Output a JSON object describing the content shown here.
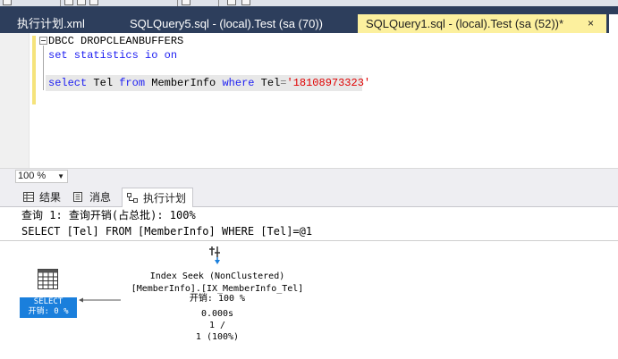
{
  "tabs": [
    {
      "label": "执行计划.xml",
      "active": false
    },
    {
      "label": "SQLQuery5.sql - (local).Test (sa (70))",
      "active": false
    },
    {
      "label": "SQLQuery1.sql - (local).Test (sa (52))*",
      "active": true
    }
  ],
  "active_tab_close": "×",
  "editor": {
    "lines": [
      {
        "kw1": "DBCC",
        "rest": " DROPCLEANBUFFERS"
      },
      {
        "kw1": "set statistics io on"
      },
      {
        "kw1": "select",
        "col": " Tel ",
        "kw2": "from",
        "tbl": " MemberInfo ",
        "kw3": "where",
        "col2": " Tel",
        "op": "=",
        "str": "'18108973323'"
      }
    ]
  },
  "zoom": {
    "value": "100 %"
  },
  "result_tabs": [
    {
      "label": "结果",
      "icon": "grid-icon"
    },
    {
      "label": "消息",
      "icon": "messages-icon"
    },
    {
      "label": "执行计划",
      "icon": "execution-plan-icon",
      "active": true
    }
  ],
  "plan": {
    "query_header": "查询 1: 查询开销(占总批): 100%",
    "statement": "SELECT [Tel] FROM [MemberInfo] WHERE [Tel]=@1",
    "select_node": {
      "name": "SELECT",
      "cost": "开销: 0 %",
      "icon": "select-operator-icon"
    },
    "seek_node": {
      "op": "Index Seek (NonClustered)",
      "object": "[MemberInfo].[IX_MemberInfo_Tel]",
      "cost": "开销: 100 %",
      "time": "0.000s",
      "rows_ratio": "1 /",
      "rows_pct": "1 (100%)",
      "icon": "index-seek-icon"
    }
  },
  "colors": {
    "tab_strip": "#2d3e5c",
    "active_tab": "#fcf09e",
    "keyword": "#1f20f2",
    "string": "#e00000",
    "selected_node": "#1a7fdc"
  }
}
